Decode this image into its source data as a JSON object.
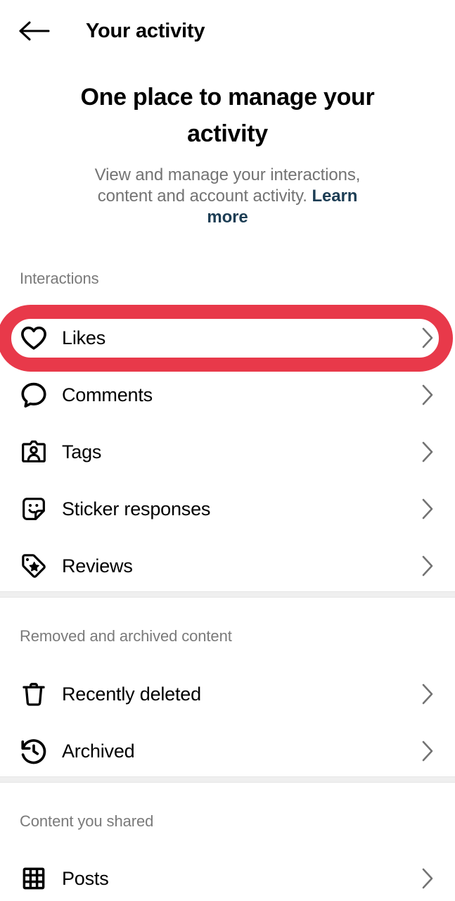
{
  "appbar": {
    "back_icon": "arrow-left-icon",
    "title": "Your activity"
  },
  "hero": {
    "title": "One place to manage your activity",
    "subtitle": "View and manage your interactions, content and account activity.",
    "link_label": "Learn more"
  },
  "sections": [
    {
      "id": "interactions",
      "label": "Interactions",
      "items": [
        {
          "id": "likes",
          "label": "Likes",
          "icon": "heart-icon",
          "highlighted": true
        },
        {
          "id": "comments",
          "label": "Comments",
          "icon": "comment-bubble-icon",
          "highlighted": false
        },
        {
          "id": "tags",
          "label": "Tags",
          "icon": "tag-person-card-icon",
          "highlighted": false
        },
        {
          "id": "sticker-responses",
          "label": "Sticker responses",
          "icon": "sticker-smiley-icon",
          "highlighted": false
        },
        {
          "id": "reviews",
          "label": "Reviews",
          "icon": "price-tag-star-icon",
          "highlighted": false
        }
      ]
    },
    {
      "id": "removed-archived",
      "label": "Removed and archived content",
      "items": [
        {
          "id": "recently-deleted",
          "label": "Recently deleted",
          "icon": "trash-icon",
          "highlighted": false
        },
        {
          "id": "archived",
          "label": "Archived",
          "icon": "clock-history-icon",
          "highlighted": false
        }
      ]
    },
    {
      "id": "content-you-shared",
      "label": "Content you shared",
      "items": [
        {
          "id": "posts",
          "label": "Posts",
          "icon": "grid-icon",
          "highlighted": false
        }
      ]
    }
  ],
  "chevron_icon": "chevron-right-icon",
  "colors": {
    "highlight_red": "#e8394a",
    "link_navy": "#1c3d54",
    "muted_gray": "#7a7a7a",
    "chevron_gray": "#737373",
    "band_gray": "#efefef"
  }
}
